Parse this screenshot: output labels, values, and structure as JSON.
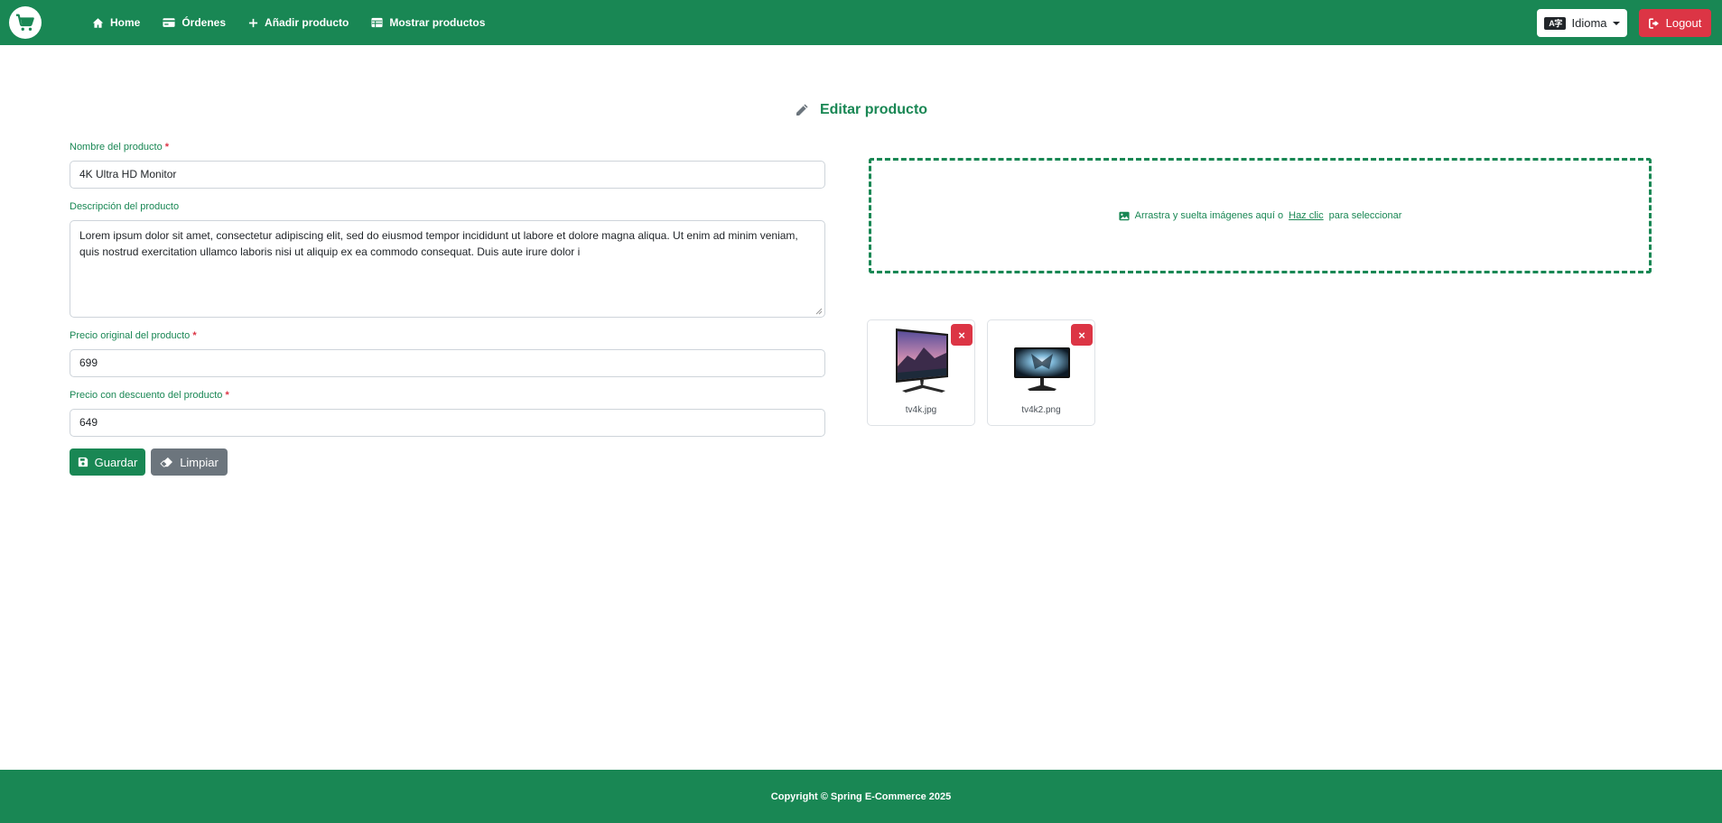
{
  "navbar": {
    "brand_icon": "cart-icon",
    "links": [
      {
        "label": "Home",
        "icon": "home-icon"
      },
      {
        "label": "Órdenes",
        "icon": "card-icon"
      },
      {
        "label": "Añadir producto",
        "icon": "plus-icon"
      },
      {
        "label": "Mostrar productos",
        "icon": "table-icon"
      }
    ],
    "language_label": "Idioma",
    "language_icon": "translate-icon",
    "logout_label": "Logout",
    "logout_icon": "logout-icon"
  },
  "page": {
    "title": "Editar producto",
    "title_icon": "pencil-icon"
  },
  "form": {
    "name_label": "Nombre del producto",
    "name_value": "4K Ultra HD Monitor",
    "description_label": "Descripción del producto",
    "description_value": "Lorem ipsum dolor sit amet, consectetur adipiscing elit, sed do eiusmod tempor incididunt ut labore et dolore magna aliqua. Ut enim ad minim veniam, quis nostrud exercitation ullamco laboris nisi ut aliquip ex ea commodo consequat. Duis aute irure dolor i",
    "original_price_label": "Precio original del producto",
    "original_price_value": "699",
    "discount_price_label": "Precio con descuento del producto",
    "discount_price_value": "649",
    "required_mark": "*",
    "save_label": "Guardar",
    "clear_label": "Limpiar"
  },
  "dropzone": {
    "text_before": "Arrastra y suelta imágenes aquí o",
    "link_text": "Haz clic",
    "text_after": "para seleccionar"
  },
  "images": [
    {
      "filename": "tv4k.jpg",
      "remove_label": "×"
    },
    {
      "filename": "tv4k2.png",
      "remove_label": "×"
    }
  ],
  "footer": {
    "copyright": "Copyright © Spring E-Commerce 2025"
  },
  "colors": {
    "primary": "#198754",
    "danger": "#dc3545",
    "secondary": "#6c757d"
  }
}
